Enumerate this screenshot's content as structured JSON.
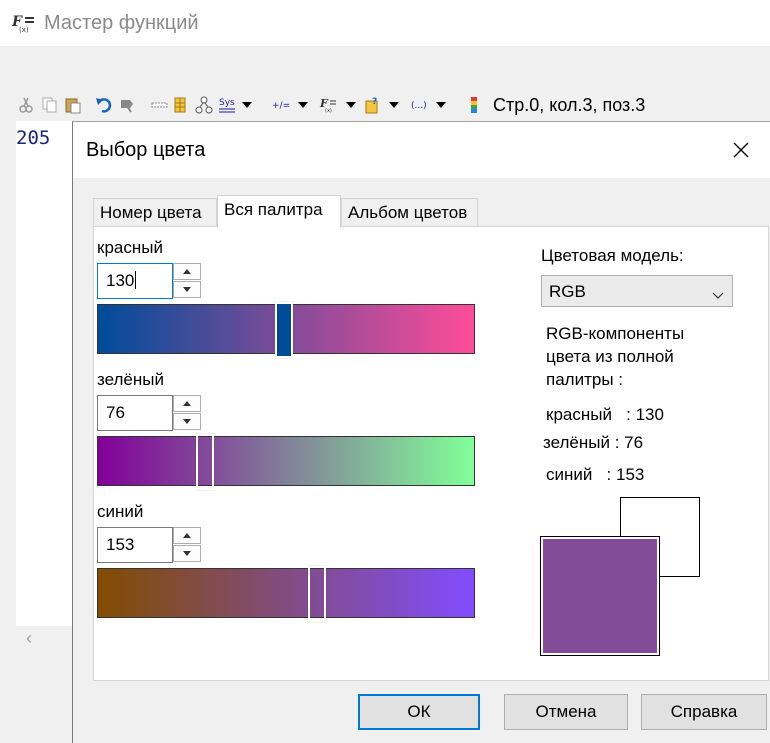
{
  "background_window": {
    "title": "Мастер функций",
    "status": "Стр.0, кол.3, поз.3",
    "editor_value": "205"
  },
  "dialog": {
    "title": "Выбор цвета",
    "tabs": [
      {
        "label": "Номер цвета",
        "active": false
      },
      {
        "label": "Вся палитра",
        "active": true
      },
      {
        "label": "Альбом цветов",
        "active": false
      }
    ],
    "channels": {
      "red": {
        "label": "красный",
        "value": "130"
      },
      "green": {
        "label": "зелёный",
        "value": "76"
      },
      "blue": {
        "label": "синий",
        "value": "153"
      }
    },
    "model_label": "Цветовая модель:",
    "model_value": "RGB",
    "info_heading_1": "RGB-компоненты",
    "info_heading_2": "цвета из полной",
    "info_heading_3": "палитры :",
    "info_red": "красный   : 130",
    "info_green": "зелёный : 76",
    "info_blue": "синий   : 153",
    "buttons": {
      "ok": "ОК",
      "cancel": "Отмена",
      "help": "Справка"
    }
  },
  "colors": {
    "current": "#824c99",
    "previous": "#ffffff",
    "accent": "#0078d7",
    "red_gradient_start": "#004c99",
    "red_gradient_end": "#ff4c99",
    "green_gradient_start": "#820099",
    "green_gradient_end": "#82ff99",
    "blue_gradient_start": "#824c00",
    "blue_gradient_end": "#824cff"
  },
  "icons": [
    "app-fx-icon",
    "cut-icon",
    "copy-icon",
    "paste-icon",
    "undo-icon",
    "redo-icon",
    "insert-icon",
    "table-icon",
    "tree-icon",
    "sys-icon",
    "plus-minus-icon",
    "function-icon",
    "help-icon",
    "brackets-icon",
    "color-bars-icon"
  ]
}
